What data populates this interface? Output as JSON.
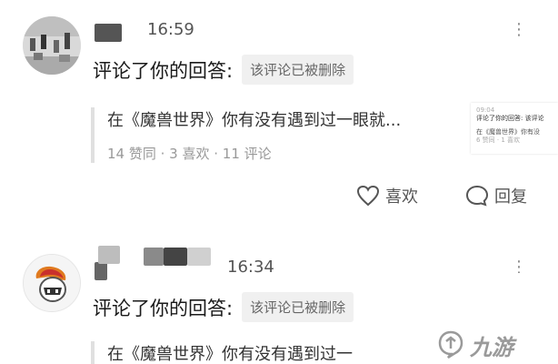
{
  "notifications": [
    {
      "time": "16:59",
      "action_text": "评论了你的回答:",
      "status_tag": "该评论已被删除",
      "quote_title": "在《魔兽世界》你有没有遇到过一眼就...",
      "quote_stats": "14 赞同 · 3 喜欢 · 11 评论",
      "like_label": "喜欢",
      "reply_label": "回复",
      "thumbnail": {
        "time": "09:04",
        "line1": "评论了你的回答:",
        "tag": "该评论",
        "line2": "在《魔兽世界》你有没",
        "line3": "6 赞同 · 1 喜欢"
      }
    },
    {
      "time": "16:34",
      "action_text": "评论了你的回答:",
      "status_tag": "该评论已被删除",
      "quote_title": "在《魔兽世界》你有没有遇到过一"
    }
  ],
  "more_icon": "⋮",
  "watermark": {
    "text": "九游"
  },
  "colors": {
    "blur_dark": "#444444",
    "blur_mid": "#8c8c8c",
    "blur_light": "#cfcfcf"
  }
}
